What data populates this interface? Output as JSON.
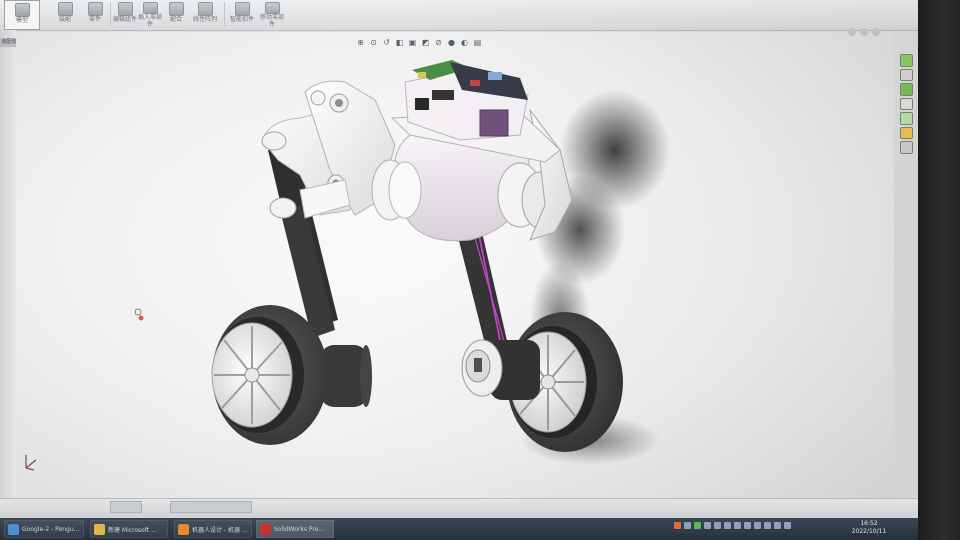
{
  "app": {
    "name": "SolidWorks"
  },
  "ribbon": {
    "buttons": [
      {
        "label": "模型"
      },
      {
        "label": "装配"
      },
      {
        "label": "零件"
      },
      {
        "label": "编辑组件"
      },
      {
        "label": "插入零部件"
      },
      {
        "label": "配合"
      },
      {
        "label": "线性阵列"
      },
      {
        "label": "智能扣件"
      },
      {
        "label": "移动零部件"
      }
    ]
  },
  "feature_manager_tab": "装配体",
  "headsup_toolbar": {
    "icons": [
      "zoom-to-fit-icon",
      "zoom-area-icon",
      "previous-view-icon",
      "section-view-icon",
      "view-orientation-icon",
      "display-style-icon",
      "hide-show-icon",
      "appearance-icon",
      "scene-icon",
      "view-settings-icon"
    ]
  },
  "taskbar": {
    "items": [
      {
        "label": "Google-2 - Pengu..."
      },
      {
        "label": "新建 Microsoft ..."
      },
      {
        "label": "机器人设计 - 机器 ..."
      },
      {
        "label": "SolidWorks Pre..."
      }
    ],
    "clock": {
      "time": "16:52",
      "date": "2022/10/11"
    }
  },
  "colors": {
    "viewport_bg": "#f2f2f2",
    "accent_pink": "#c43fd0",
    "model_white": "#f4f4f4",
    "tire": "#3a3a3a",
    "pcb_green": "#3f8a3a"
  }
}
